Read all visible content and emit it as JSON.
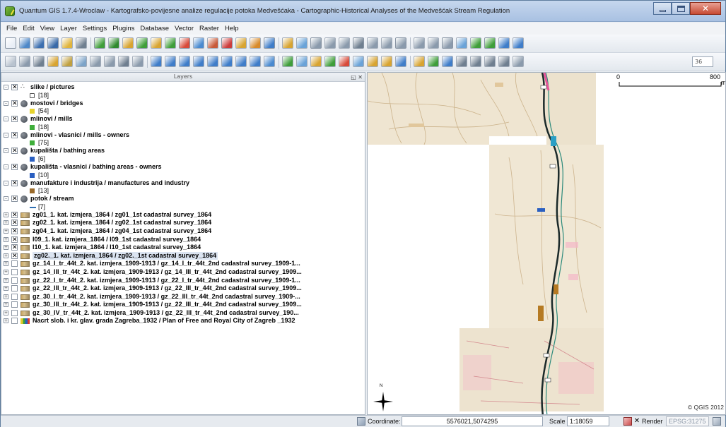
{
  "window": {
    "title": "Quantum GIS 1.7.4-Wroclaw - Kartografsko-povijesne analize regulacije potoka Medvešćaka - Cartographic-Historical Analyses of the Medvešćak Stream Regulation",
    "close_glyph": "✕"
  },
  "menu": [
    "File",
    "Edit",
    "View",
    "Layer",
    "Settings",
    "Plugins",
    "Database",
    "Vector",
    "Raster",
    "Help"
  ],
  "toolbar": {
    "zoom_value": "36"
  },
  "layers_panel": {
    "title": "Layers",
    "panel_buttons": "◱ ✕",
    "checked_mark": "✕",
    "expand_mark": "–",
    "collapsed_mark": "+",
    "vector_layers": [
      {
        "name": "slike / pictures",
        "count": "[18]",
        "icon": "dots-icon",
        "symbol_color": "#7f7f7f"
      },
      {
        "name": "mostovi / bridges",
        "count": "[54]",
        "icon": "globe-icon",
        "symbol_color": "#e6d32c"
      },
      {
        "name": "mlinovi / mills",
        "count": "[18]",
        "icon": "globe-icon",
        "symbol_color": "#3fae3a"
      },
      {
        "name": "mlinovi - vlasnici / mills - owners",
        "count": "[75]",
        "icon": "globe-icon",
        "symbol_color": "#3fae3a"
      },
      {
        "name": "kupališta / bathing areas",
        "count": "[6]",
        "icon": "globe-icon",
        "symbol_color": "#2a5fc1"
      },
      {
        "name": "kupališta - vlasnici / bathing areas - owners",
        "count": "[10]",
        "icon": "globe-icon",
        "symbol_color": "#2a5fc1"
      },
      {
        "name": "manufakture i industrija / manufactures and industry",
        "count": "[13]",
        "icon": "globe-icon",
        "symbol_color": "#9a6a2a"
      },
      {
        "name": "potok / stream",
        "count": "[7]",
        "icon": "globe-icon",
        "symbol_color": "#2f6fb2"
      }
    ],
    "raster_layers": [
      {
        "name": "zg01_1. kat. izmjera_1864 / zg01_1st cadastral survey_1864",
        "checked": true
      },
      {
        "name": "zg02_1. kat. izmjera_1864 / zg02_1st cadastral survey_1864",
        "checked": true
      },
      {
        "name": "zg04_1. kat. izmjera_1864 / zg04_1st cadastral survey_1864",
        "checked": true
      },
      {
        "name": "l09_1. kat. izmjera_1864 / l09_1st cadastral survey_1864",
        "checked": true
      },
      {
        "name": "l10_1. kat. izmjera_1864 / l10_1st cadastral survey_1864",
        "checked": true
      },
      {
        "name": "zg02._1. kat. izmjera_1864 / zg02._1st cadastral survey_1864",
        "checked": true,
        "selected": true
      },
      {
        "name": "gz_14_I_tr_44t_2. kat. izmjera_1909-1913 / gz_14_I_tr_44t_2nd cadastral survey_1909-1...",
        "checked": false
      },
      {
        "name": "gz_14_III_tr_44t_2. kat. izmjera_1909-1913 / gz_14_III_tr_44t_2nd cadastral survey_1909...",
        "checked": false
      },
      {
        "name": "gz_22_I_tr_44t_2. kat. izmjera_1909-1913 / gz_22_I_tr_44t_2nd cadastral survey_1909-1...",
        "checked": false
      },
      {
        "name": "gz_22_III_tr_44t_2. kat. izmjera_1909-1913 / gz_22_III_tr_44t_2nd cadastral survey_1909...",
        "checked": false
      },
      {
        "name": "gz_30_I_tr_44t_2. kat. izmjera_1909-1913 / gz_22_III_tr_44t_2nd cadastral survey_1909-...",
        "checked": false
      },
      {
        "name": "gz_30_III_tr_44t_2. kat. izmjera_1909-1913 / gz_22_III_tr_44t_2nd cadastral survey_1909...",
        "checked": false
      },
      {
        "name": "gz_30_IV_tr_44t_2. kat. izmjera_1909-1913 / gz_22_III_tr_44t_2nd cadastral survey_190...",
        "checked": false
      },
      {
        "name": "Nacrt slob. i kr. glav. grada Zagreba_1932 / Plan of Free and Royal City of Zagreb _1932",
        "checked": false,
        "multicolor": true
      }
    ]
  },
  "map": {
    "scale_start": "0",
    "scale_end": "800",
    "scale_unit": "m",
    "copyright": "© QGIS 2012",
    "north_label": "N"
  },
  "statusbar": {
    "coordinate_label": "Coordinate:",
    "coordinate_value": "5576021,5074295",
    "scale_label": "Scale",
    "scale_value": "1:18059",
    "render_label": "Render",
    "render_mark": "✕",
    "crs": "EPSG:31275"
  }
}
